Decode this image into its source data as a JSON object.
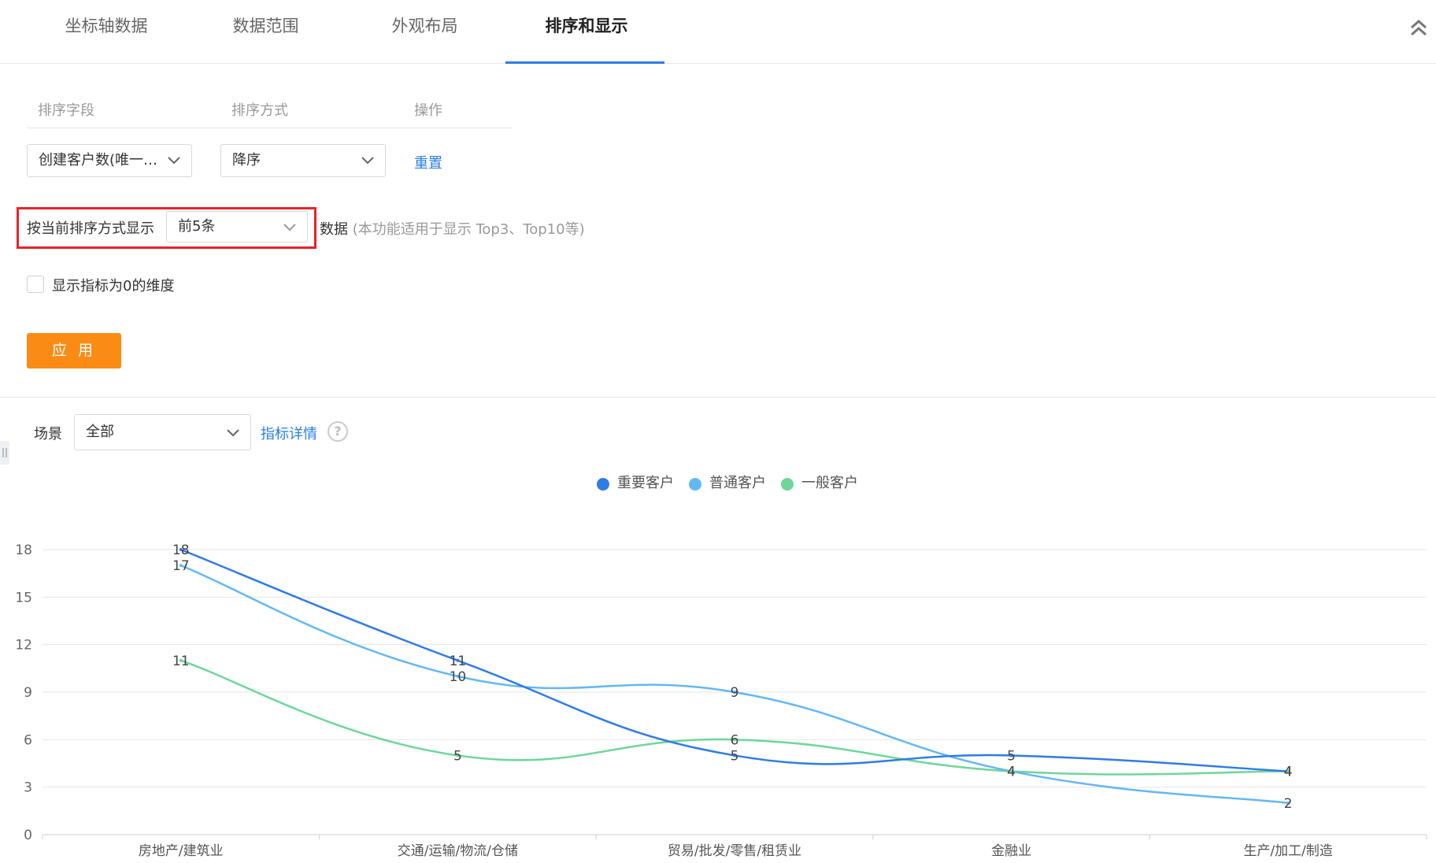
{
  "tabs": [
    {
      "label": "坐标轴数据"
    },
    {
      "label": "数据范围"
    },
    {
      "label": "外观布局"
    },
    {
      "label": "排序和显示"
    }
  ],
  "sort_table": {
    "headers": [
      "排序字段",
      "排序方式",
      "操作"
    ],
    "field_value": "创建客户数(唯一…",
    "order_value": "降序",
    "reset_label": "重置"
  },
  "top_n": {
    "label": "按当前排序方式显示",
    "value": "前5条",
    "suffix": "数据",
    "hint": "(本功能适用于显示 Top3、Top10等)"
  },
  "show_zero": {
    "label": "显示指标为0的维度",
    "checked": false
  },
  "apply_label": "应 用",
  "scene": {
    "label": "场景",
    "value": "全部",
    "detail_link": "指标详情"
  },
  "colors": {
    "accent": "#2b7de9",
    "apply": "#fa8c16",
    "highlight": "#e8232a"
  },
  "chart_data": {
    "type": "line",
    "categories": [
      "房地产/建筑业",
      "交通/运输/物流/仓储",
      "贸易/批发/零售/租赁业",
      "金融业",
      "生产/加工/制造"
    ],
    "series": [
      {
        "name": "重要客户",
        "values": [
          18,
          11,
          5,
          5,
          4
        ],
        "color": "#2f7be8"
      },
      {
        "name": "普通客户",
        "values": [
          17,
          10,
          9,
          4,
          2
        ],
        "color": "#63b8f4"
      },
      {
        "name": "一般客户",
        "values": [
          11,
          5,
          6,
          4,
          4
        ],
        "color": "#6ed699"
      }
    ],
    "ylim": [
      0,
      18
    ],
    "yticks": [
      0,
      3,
      6,
      9,
      12,
      15,
      18
    ],
    "grid": true,
    "legend": "top-center",
    "smooth": true,
    "data_labels": true
  }
}
